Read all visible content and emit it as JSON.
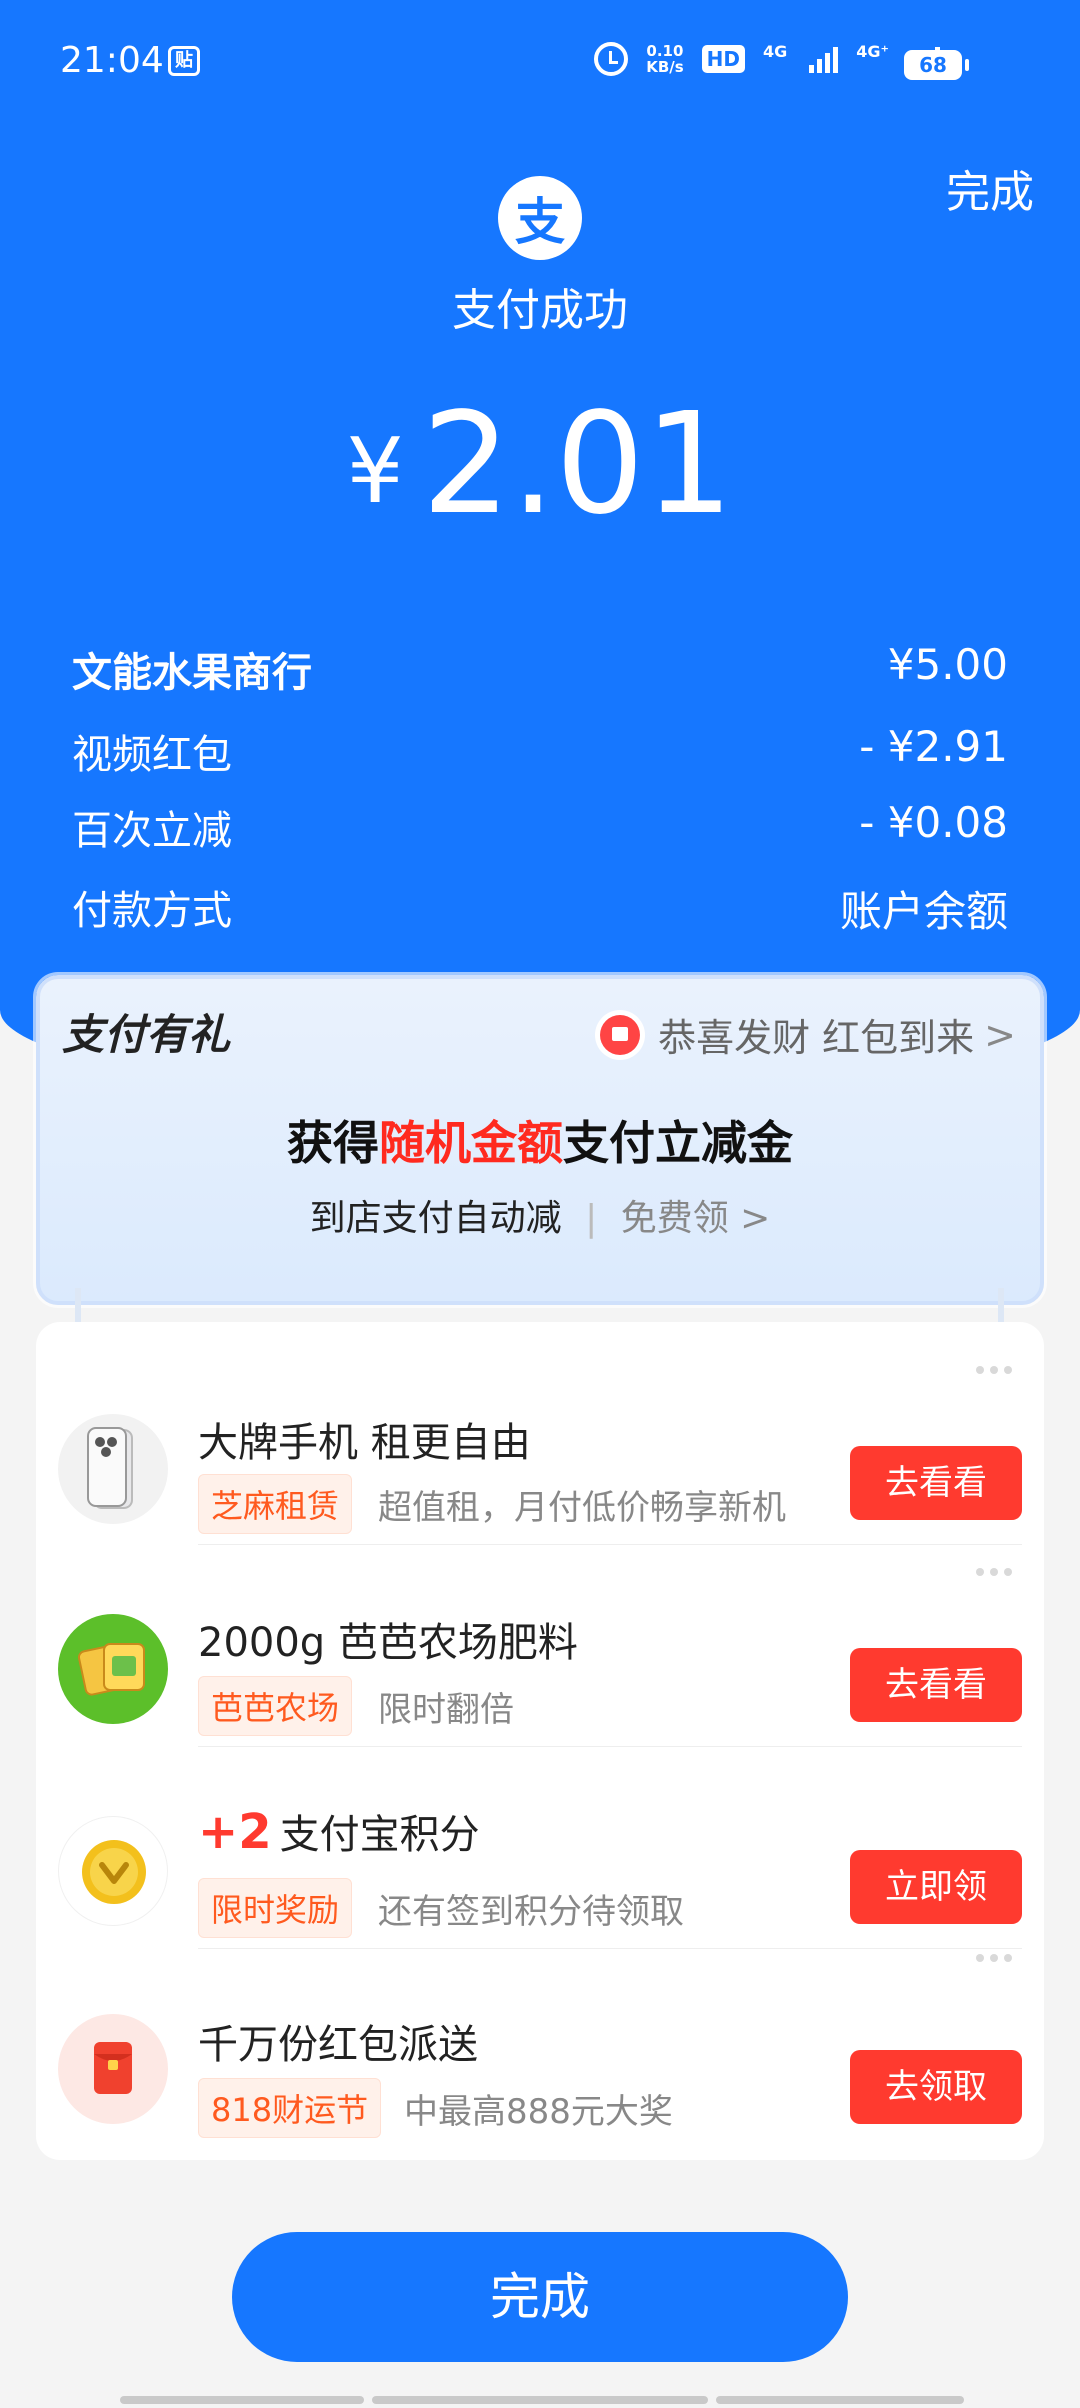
{
  "status_bar": {
    "time": "21:04",
    "sticker": "贴",
    "net_speed_value": "0.10",
    "net_speed_unit": "KB/s",
    "hd": "HD",
    "sim1_label": "4G",
    "sim2_label": "4G⁺",
    "battery": "68"
  },
  "header": {
    "done_label": "完成",
    "logo_glyph": "支",
    "success_text": "支付成功"
  },
  "amount": {
    "currency": "¥",
    "value": "2.01"
  },
  "details": [
    {
      "label": "文能水果商行",
      "value": "¥5.00"
    },
    {
      "label": "视频红包",
      "value": "- ¥2.91"
    },
    {
      "label": "百次立减",
      "value": "- ¥0.08"
    },
    {
      "label": "付款方式",
      "value": "账户余额"
    }
  ],
  "promo": {
    "title": "支付有礼",
    "right_text": "恭喜发财 红包到来",
    "main_prefix": "获得",
    "main_highlight": "随机金额",
    "main_suffix": "支付立减金",
    "sub_text": "到店支付自动减",
    "sub_separator": "|",
    "sub_link": "免费领",
    "chevron": ">"
  },
  "offers": [
    {
      "title": "大牌手机 租更自由",
      "tag": "芝麻租赁",
      "desc": "超值租，月付低价畅享新机",
      "button": "去看看"
    },
    {
      "title": "2000g 芭芭农场肥料",
      "tag": "芭芭农场",
      "desc": "限时翻倍",
      "button": "去看看"
    },
    {
      "plus": "+2",
      "title": "支付宝积分",
      "tag": "限时奖励",
      "desc": "还有签到积分待领取",
      "button": "立即领"
    },
    {
      "title": "千万份红包派送",
      "tag": "818财运节",
      "desc": "中最高888元大奖",
      "button": "去领取"
    }
  ],
  "footer": {
    "done_label": "完成"
  },
  "colors": {
    "brand_blue": "#1677ff",
    "action_red": "#ff3a2f",
    "tag_orange": "#ff5a1f"
  }
}
